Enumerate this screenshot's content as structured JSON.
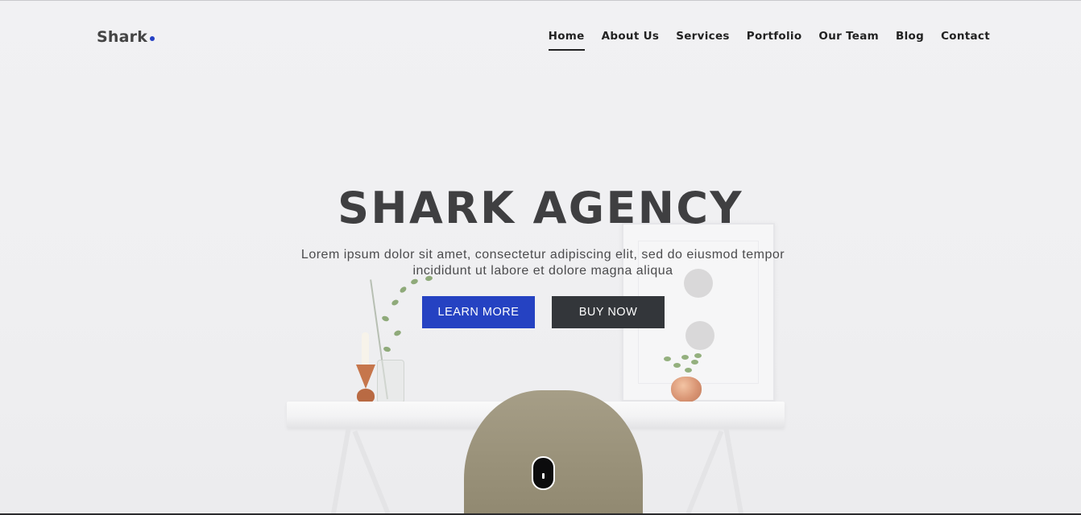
{
  "header": {
    "brand": "Shark",
    "nav": [
      {
        "label": "Home",
        "active": true
      },
      {
        "label": "About Us",
        "active": false
      },
      {
        "label": "Services",
        "active": false
      },
      {
        "label": "Portfolio",
        "active": false
      },
      {
        "label": "Our Team",
        "active": false
      },
      {
        "label": "Blog",
        "active": false
      },
      {
        "label": "Contact",
        "active": false
      }
    ]
  },
  "hero": {
    "title": "SHARK AGENCY",
    "text": "Lorem ipsum dolor sit amet, consectetur adipiscing elit, sed do eiusmod tempor incididunt ut labore et dolore magna aliqua",
    "learn_more_label": "LEARN MORE",
    "buy_now_label": "BUY NOW"
  },
  "colors": {
    "accent": "#2542c2",
    "dark_button": "#33363a",
    "title": "#3f3f41",
    "background": "#f0f0f2"
  },
  "icons": {
    "scroll": "mouse-scroll-icon",
    "brand_dot": "dot-icon"
  }
}
